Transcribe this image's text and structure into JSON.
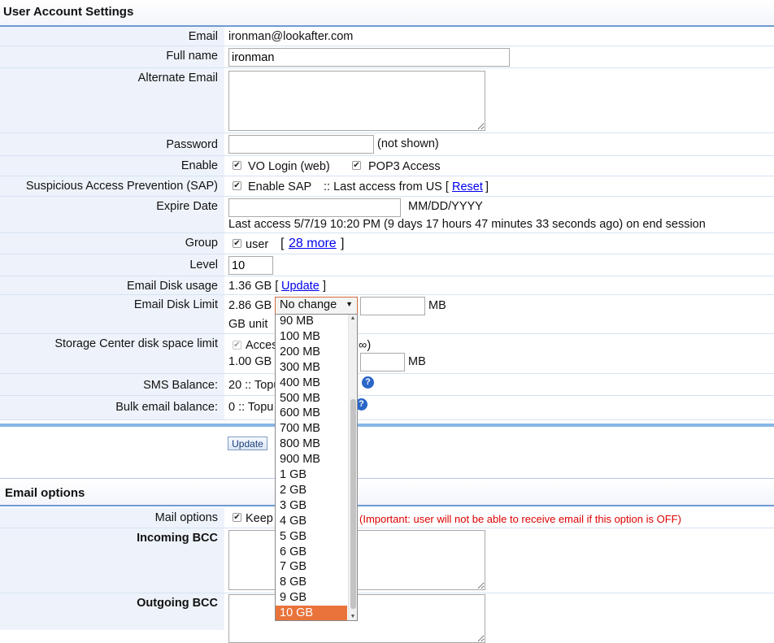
{
  "account_section": {
    "title": "User Account Settings",
    "email": {
      "label": "Email",
      "value": "ironman@lookafter.com"
    },
    "full_name": {
      "label": "Full name",
      "value": "ironman"
    },
    "alternate_email": {
      "label": "Alternate Email",
      "value": ""
    },
    "password": {
      "label": "Password",
      "value": "",
      "note": "(not shown)"
    },
    "enable": {
      "label": "Enable",
      "vo_login": "VO Login (web)",
      "pop3": "POP3 Access"
    },
    "sap": {
      "label": "Suspicious Access Prevention (SAP)",
      "enable_label": "Enable SAP",
      "last_access": ":: Last access from US [",
      "reset": "Reset",
      "close": "]"
    },
    "expire": {
      "label": "Expire Date",
      "value": "",
      "format": "MM/DD/YYYY",
      "last_access": "Last access 5/7/19 10:20 PM (9 days 17 hours 47 minutes 33 seconds ago) on end session"
    },
    "group": {
      "label": "Group",
      "value": "user",
      "open": "[",
      "more": "28 more",
      "close": "]"
    },
    "level": {
      "label": "Level",
      "value": "10"
    },
    "disk_usage": {
      "label": "Email Disk usage",
      "value": "1.36 GB [",
      "update": "Update",
      "close": "]"
    },
    "disk_limit": {
      "label": "Email Disk Limit",
      "value": "2.86 GB",
      "selected": "No change",
      "unit": "MB",
      "gb_unit": "GB unit",
      "options": [
        "90 MB",
        "100 MB",
        "200 MB",
        "300 MB",
        "400 MB",
        "500 MB",
        "600 MB",
        "700 MB",
        "800 MB",
        "900 MB",
        "1 GB",
        "2 GB",
        "3 GB",
        "4 GB",
        "5 GB",
        "6 GB",
        "7 GB",
        "8 GB",
        "9 GB",
        "10 GB"
      ],
      "highlighted": "10 GB"
    },
    "storage": {
      "label": "Storage Center disk space limit",
      "access": "Acces",
      "access_tail": "∞)",
      "value": "1.00 GB",
      "unit": "MB"
    },
    "sms": {
      "label": "SMS Balance:",
      "value": "20 :: Topu"
    },
    "bulk": {
      "label": "Bulk email balance:",
      "value": "0 :: Topu"
    },
    "update_button": "Update"
  },
  "email_section": {
    "title": "Email options",
    "mail_options": {
      "label": "Mail options",
      "keep": "Keep",
      "warning": "(Important: user will not be able to receive email if this option is OFF)"
    },
    "incoming_bcc": {
      "label": "Incoming BCC"
    },
    "outgoing_bcc": {
      "label": "Outgoing BCC"
    }
  },
  "colors": {
    "label_bg": "#eef3fb",
    "accent": "#6f9ad0",
    "highlight": "#e9733a",
    "warning": "#dd0000",
    "link": "#0000ee"
  }
}
